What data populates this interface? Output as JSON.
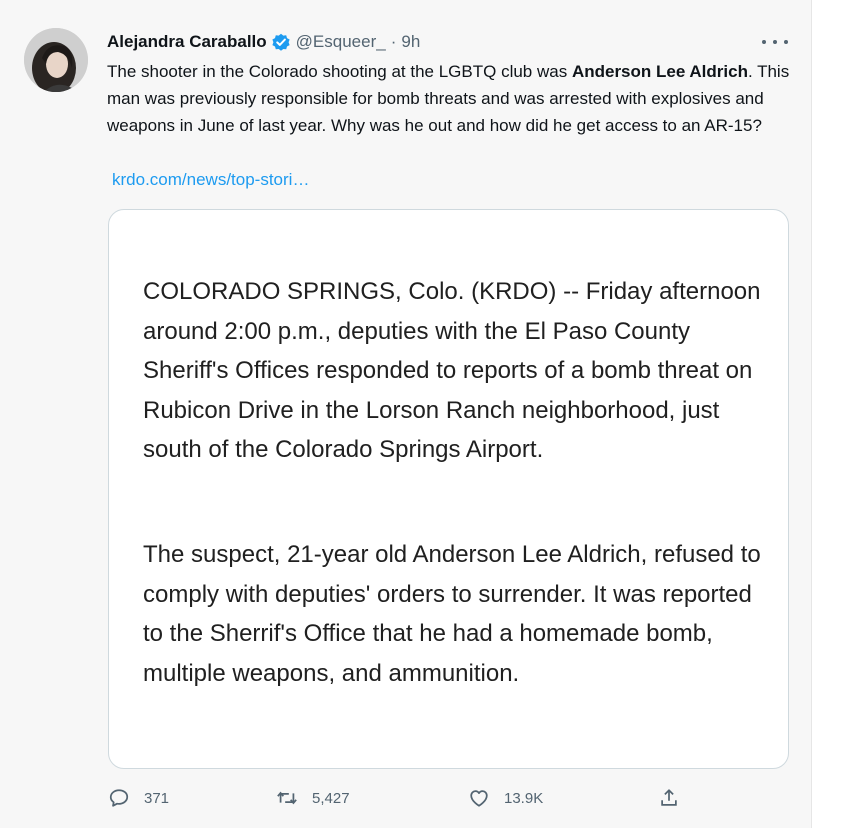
{
  "author": {
    "name": "Alejandra Caraballo",
    "handle": "@Esqueer_",
    "dot": "·",
    "time": "9h"
  },
  "tweet": {
    "text_before": "The shooter in the Colorado shooting at the LGBTQ club was ",
    "text_bold": "Anderson Lee Aldrich",
    "text_after": ". This man was previously responsible for bomb threats and was arrested with explosives and weapons in June of last year. Why was he out and how did he get access to an AR-15?",
    "link": "krdo.com/news/top-stori…"
  },
  "card": {
    "paragraph1": "COLORADO SPRINGS, Colo. (KRDO) -- Friday afternoon around 2:00 p.m., deputies with the El Paso County Sheriff's Offices responded to reports of a bomb threat on Rubicon Drive in the Lorson Ranch neighborhood, just south of the Colorado Springs Airport.",
    "paragraph2": "The suspect, 21-year old Anderson Lee Aldrich, refused to comply with deputies' orders to surrender. It was reported to the Sherrif's Office that he had a homemade bomb, multiple weapons, and ammunition."
  },
  "actions": {
    "replies": "371",
    "retweets": "5,427",
    "likes": "13.9K"
  },
  "icons": {
    "verified": "verified-badge-icon",
    "more": "more-dots-icon",
    "reply": "reply-icon",
    "retweet": "retweet-icon",
    "like": "heart-icon",
    "share": "share-icon"
  },
  "colors": {
    "accent": "#1d9bf0",
    "text": "#0f1419",
    "muted": "#536471"
  }
}
